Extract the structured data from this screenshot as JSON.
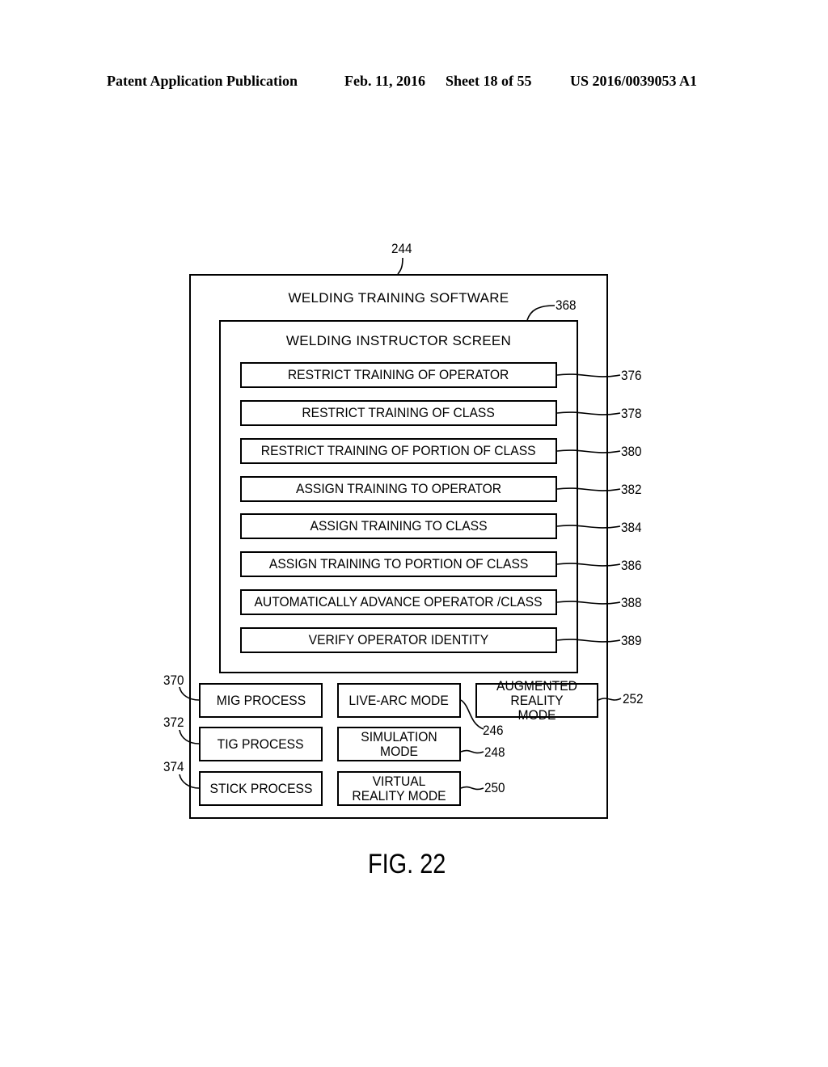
{
  "header": {
    "publication": "Patent Application Publication",
    "date": "Feb. 11, 2016",
    "sheet": "Sheet 18 of 55",
    "patent_number": "US 2016/0039053 A1"
  },
  "diagram": {
    "outer": {
      "ref": "244",
      "title": "WELDING TRAINING SOFTWARE"
    },
    "inner": {
      "ref": "368",
      "title": "WELDING INSTRUCTOR SCREEN",
      "items": [
        {
          "label": "RESTRICT TRAINING OF OPERATOR",
          "ref": "376"
        },
        {
          "label": "RESTRICT TRAINING OF CLASS",
          "ref": "378"
        },
        {
          "label": "RESTRICT TRAINING OF PORTION OF CLASS",
          "ref": "380"
        },
        {
          "label": "ASSIGN TRAINING TO OPERATOR",
          "ref": "382"
        },
        {
          "label": "ASSIGN TRAINING TO CLASS",
          "ref": "384"
        },
        {
          "label": "ASSIGN TRAINING TO PORTION OF CLASS",
          "ref": "386"
        },
        {
          "label": "AUTOMATICALLY ADVANCE OPERATOR /CLASS",
          "ref": "388"
        },
        {
          "label": "VERIFY OPERATOR IDENTITY",
          "ref": "389"
        }
      ]
    },
    "processes": [
      {
        "label": "MIG PROCESS",
        "ref": "370"
      },
      {
        "label": "TIG PROCESS",
        "ref": "372"
      },
      {
        "label": "STICK PROCESS",
        "ref": "374"
      }
    ],
    "modes": [
      {
        "label": "LIVE-ARC MODE",
        "ref": "246"
      },
      {
        "label": "SIMULATION MODE",
        "ref": "248"
      },
      {
        "label": "VIRTUAL REALITY MODE",
        "ref": "250"
      },
      {
        "label": "AUGMENTED REALITY MODE",
        "ref": "252"
      }
    ]
  },
  "figure_label": "FIG. 22"
}
